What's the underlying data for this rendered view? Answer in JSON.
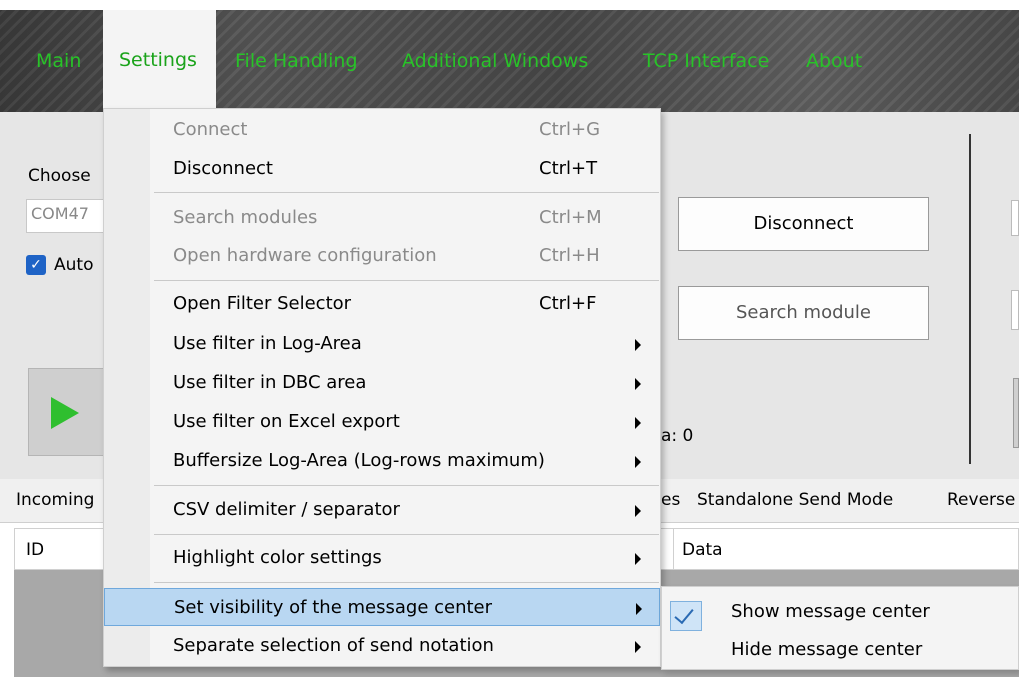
{
  "menubar": {
    "items": [
      "Main",
      "Settings",
      "File Handling",
      "Additional Windows",
      "TCP Interface",
      "About"
    ]
  },
  "panel": {
    "choose_label": "Choose",
    "port_value": "COM47",
    "auto_label": "Auto",
    "disconnect_button": "Disconnect",
    "search_module_button": "Search module",
    "data_count_label": "a: 0"
  },
  "tabs": {
    "items": [
      "Incoming",
      "es",
      "Standalone Send Mode",
      "Reverse"
    ]
  },
  "grid": {
    "columns": [
      "ID",
      "Data"
    ]
  },
  "dropdown": {
    "items": [
      {
        "label": "Connect",
        "shortcut": "Ctrl+G",
        "disabled": true
      },
      {
        "label": "Disconnect",
        "shortcut": "Ctrl+T",
        "disabled": false
      },
      {
        "label": "Search modules",
        "shortcut": "Ctrl+M",
        "disabled": true
      },
      {
        "label": "Open hardware configuration",
        "shortcut": "Ctrl+H",
        "disabled": true
      },
      {
        "label": "Open Filter Selector",
        "shortcut": "Ctrl+F",
        "disabled": false
      },
      {
        "label": "Use filter in Log-Area",
        "shortcut": "",
        "disabled": false
      },
      {
        "label": "Use filter in DBC area",
        "shortcut": "",
        "disabled": false
      },
      {
        "label": "Use filter on Excel export",
        "shortcut": "",
        "disabled": false
      },
      {
        "label": "Buffersize Log-Area (Log-rows maximum)",
        "shortcut": "",
        "disabled": false
      },
      {
        "label": "CSV delimiter / separator",
        "shortcut": "",
        "disabled": false
      },
      {
        "label": "Highlight color settings",
        "shortcut": "",
        "disabled": false
      },
      {
        "label": "Set visibility of the message center",
        "shortcut": "",
        "disabled": false
      },
      {
        "label": "Separate selection of send notation",
        "shortcut": "",
        "disabled": false
      }
    ]
  },
  "submenu": {
    "items": [
      "Show message center",
      "Hide message center"
    ],
    "checked": "Show message center"
  },
  "colors": {
    "menu_text": "#28c328",
    "highlight": "#b9d7f2",
    "checkbox": "#1e63c6",
    "play": "#2fbf2f"
  }
}
